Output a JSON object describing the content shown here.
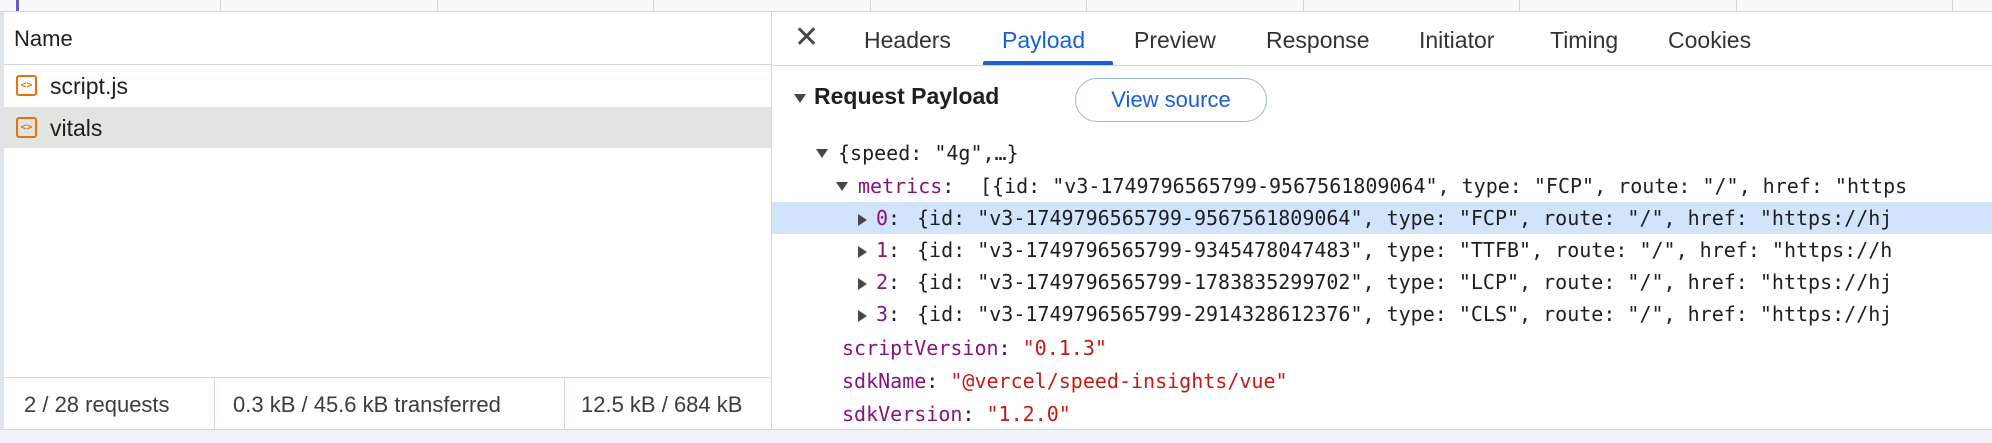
{
  "requests": {
    "column_name": "Name",
    "items": [
      {
        "name": "script.js",
        "icon": "script-file-icon"
      },
      {
        "name": "vitals",
        "icon": "script-file-icon"
      }
    ],
    "status": {
      "count": "2 / 28 requests",
      "transferred": "0.3 kB / 45.6 kB transferred",
      "resources": "12.5 kB / 684 kB"
    }
  },
  "details": {
    "tabs": [
      "Headers",
      "Payload",
      "Preview",
      "Response",
      "Initiator",
      "Timing",
      "Cookies"
    ],
    "active_tab": "Payload",
    "section_title": "Request Payload",
    "view_source_label": "View source",
    "tree": {
      "root": "{speed: \"4g\",…}",
      "metrics_key": "metrics",
      "metrics_summary": "[{id: \"v3-1749796565799-9567561809064\", type: \"FCP\", route: \"/\", href: \"https",
      "metrics_items": [
        {
          "idx": "0",
          "text": "{id: \"v3-1749796565799-9567561809064\", type: \"FCP\", route: \"/\", href: \"https://hj"
        },
        {
          "idx": "1",
          "text": "{id: \"v3-1749796565799-9345478047483\", type: \"TTFB\", route: \"/\", href: \"https://h"
        },
        {
          "idx": "2",
          "text": "{id: \"v3-1749796565799-1783835299702\", type: \"LCP\", route: \"/\", href: \"https://hj"
        },
        {
          "idx": "3",
          "text": "{id: \"v3-1749796565799-2914328612376\", type: \"CLS\", route: \"/\", href: \"https://hj"
        }
      ],
      "props": [
        {
          "key": "scriptVersion",
          "value": "\"0.1.3\""
        },
        {
          "key": "sdkName",
          "value": "\"@vercel/speed-insights/vue\""
        },
        {
          "key": "sdkVersion",
          "value": "\"1.2.0\""
        }
      ]
    }
  },
  "colors": {
    "accent": "#1a5fd4",
    "key": "#881280",
    "string": "#c41a16",
    "selected_row": "#d2e3fc"
  }
}
